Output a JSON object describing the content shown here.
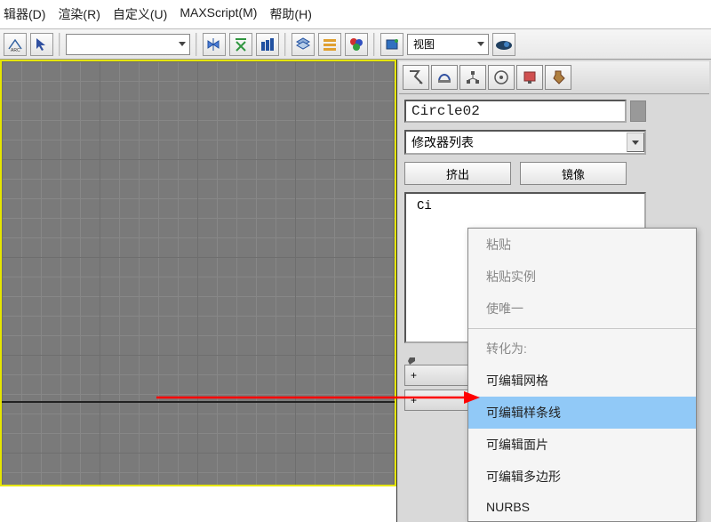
{
  "menu": {
    "editor": "辑器(D)",
    "render": "渲染(R)",
    "customize": "自定义(U)",
    "maxscript": "MAXScript(M)",
    "help": "帮助(H)"
  },
  "toolbar": {
    "view_dropdown_label": "视图"
  },
  "panel": {
    "object_name": "Circle02",
    "modifier_combo_label": "修改器列表",
    "extrude_btn": "挤出",
    "mirror_btn": "镜像",
    "stack_item": "Ci"
  },
  "context_menu": {
    "paste": "粘贴",
    "paste_instance": "粘贴实例",
    "make_unique": "使唯一",
    "convert_label": "转化为:",
    "conv_mesh": "可编辑网格",
    "conv_spline": "可编辑样条线",
    "conv_patch": "可编辑面片",
    "conv_poly": "可编辑多边形",
    "conv_nurbs": "NURBS"
  },
  "rollout": {
    "plus": "+"
  }
}
